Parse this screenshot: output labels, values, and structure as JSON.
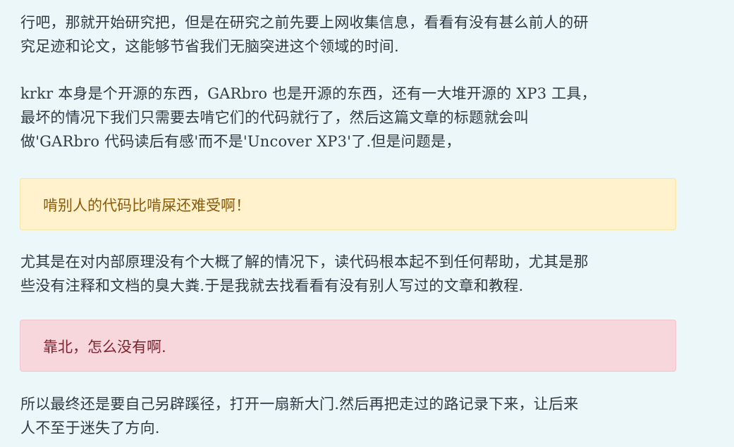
{
  "article": {
    "paragraph1": {
      "line1": "行吧，那就开始研究把，但是在研究之前先要上网收集信息，看看有没有甚么前人的研",
      "line2": "究足迹和论文，这能够节省我们无脑突进这个领域的时间."
    },
    "paragraph2": {
      "line1": "krkr 本身是个开源的东西，GARbro 也是开源的东西，还有一大堆开源的 XP3 工具，",
      "line2": "最坏的情况下我们只需要去啃它们的代码就行了，然后这篇文章的标题就会叫",
      "line3": "做'GARbro 代码读后有感'而不是'Uncover XP3'了.但是问题是，"
    },
    "warning": {
      "text": "啃别人的代码比啃屎还难受啊！"
    },
    "paragraph3": {
      "line1": "尤其是在对内部原理没有个大概了解的情况下，读代码根本起不到任何帮助，尤其是那",
      "line2": "些没有注释和文档的臭大粪.于是我就去找看看有没有别人写过的文章和教程."
    },
    "danger": {
      "text": "靠北，怎么没有啊."
    },
    "paragraph4": {
      "line1": "所以最终还是要自己另辟蹊径，打开一扇新大门.然后再把走过的路记录下来，让后来",
      "line2": "人不至于迷失了方向."
    }
  },
  "colors": {
    "page_background": "#ebf7f9",
    "warning_background": "#fff2cc",
    "warning_text": "#8a5a0a",
    "danger_background": "#f8d7dc",
    "danger_text": "#7d2330"
  }
}
